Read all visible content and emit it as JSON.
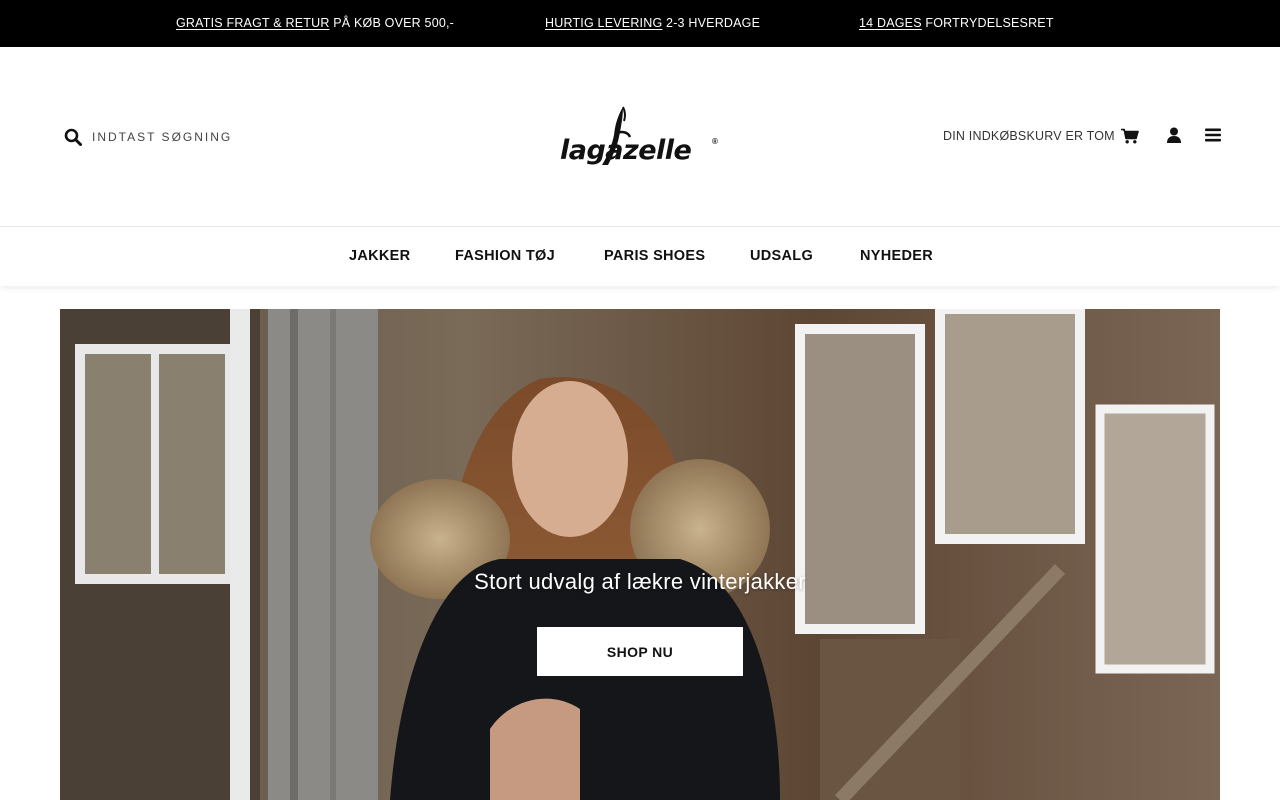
{
  "topbar": {
    "messages": [
      {
        "link": "GRATIS FRAGT & RETUR",
        "text": " PÅ KØB OVER 500,-"
      },
      {
        "link": "HURTIG LEVERING",
        "text": " 2-3 HVERDAGE"
      },
      {
        "link": "14 DAGES",
        "text": " FORTRYDELSESRET"
      }
    ]
  },
  "header": {
    "search_label": "INDTAST SØGNING",
    "search_icon": "search-icon",
    "logo_text": "lagazelle",
    "logo_mark": "®",
    "cart_label": "DIN INDKØBSKURV ER TOM",
    "cart_icon": "cart-icon",
    "user_icon": "user-icon",
    "menu_icon": "hamburger-menu-icon"
  },
  "nav": {
    "items": [
      "JAKKER",
      "FASHION TØJ",
      "PARIS SHOES",
      "UDSALG",
      "NYHEDER"
    ]
  },
  "hero": {
    "headline": "Stort udvalg af lækre vinterjakker",
    "cta_label": "SHOP NU"
  },
  "colors": {
    "topbar_bg": "#000000",
    "text": "#111111",
    "cta_bg": "#ffffff"
  }
}
